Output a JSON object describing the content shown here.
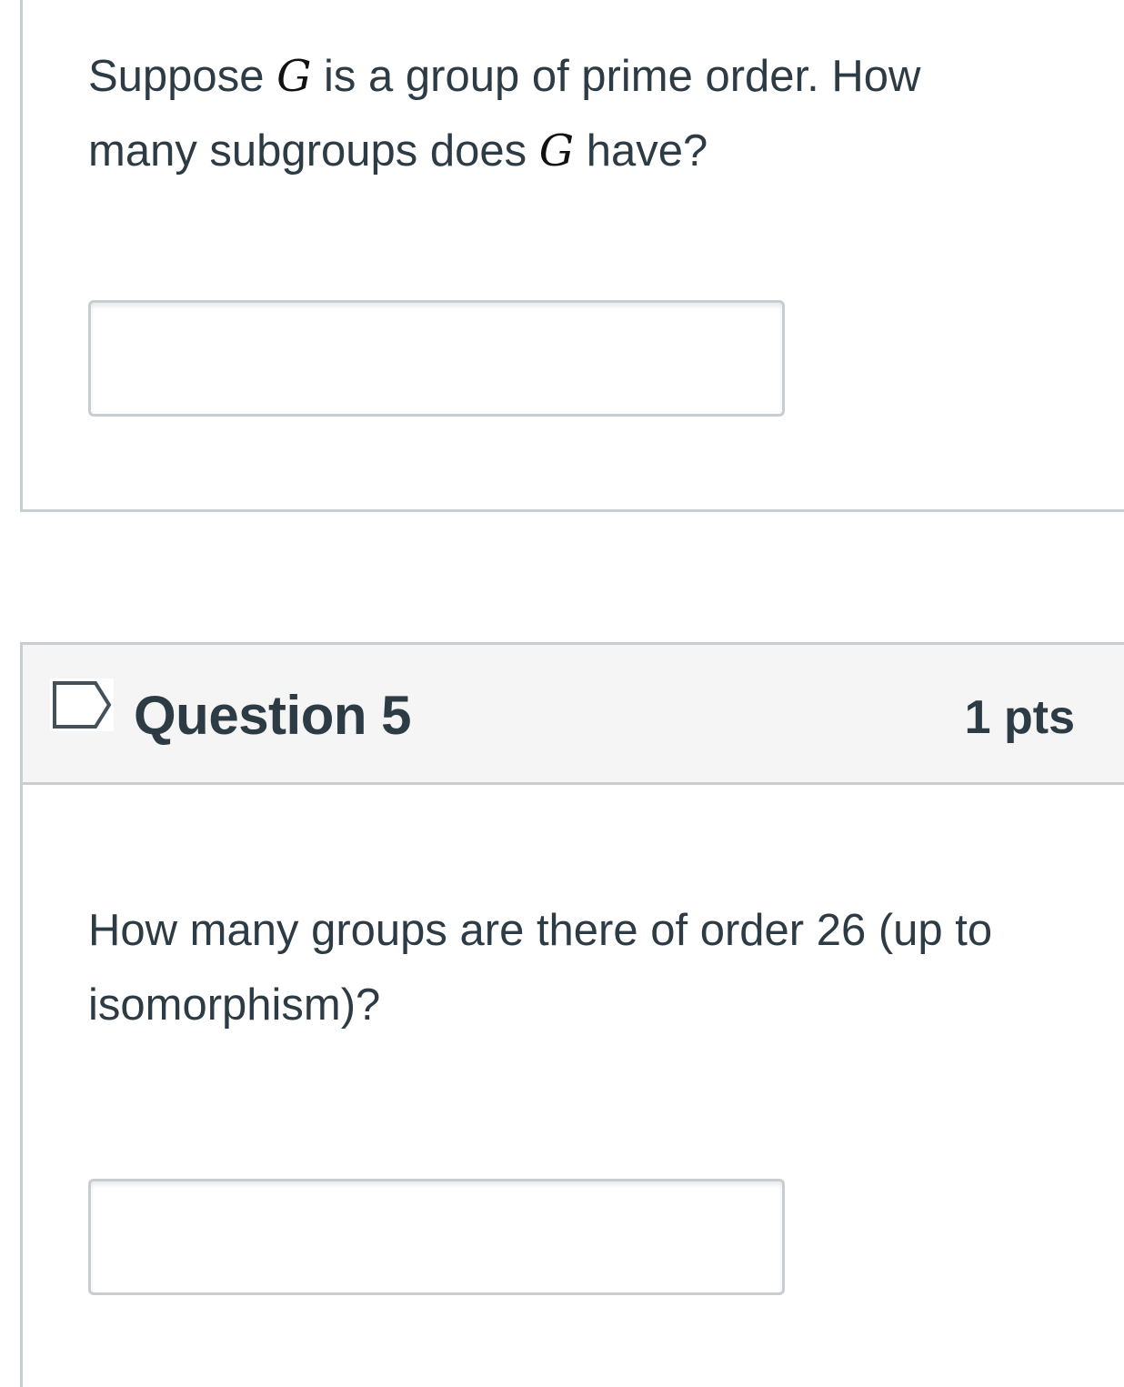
{
  "question_4": {
    "text_part1": "Suppose ",
    "var1": "G",
    "text_part2": " is a group of prime order. How many subgroups does ",
    "var2": "G",
    "text_part3": " have?",
    "answer_value": ""
  },
  "question_5": {
    "title": "Question 5",
    "points": "1 pts",
    "flag_icon": "flag-outline-icon",
    "text": "How many groups are there of order 26 (up to isomorphism)?",
    "answer_value": ""
  },
  "colors": {
    "text": "#2d3b45",
    "border": "#c7cdd1",
    "header_bg": "#f5f5f5"
  }
}
